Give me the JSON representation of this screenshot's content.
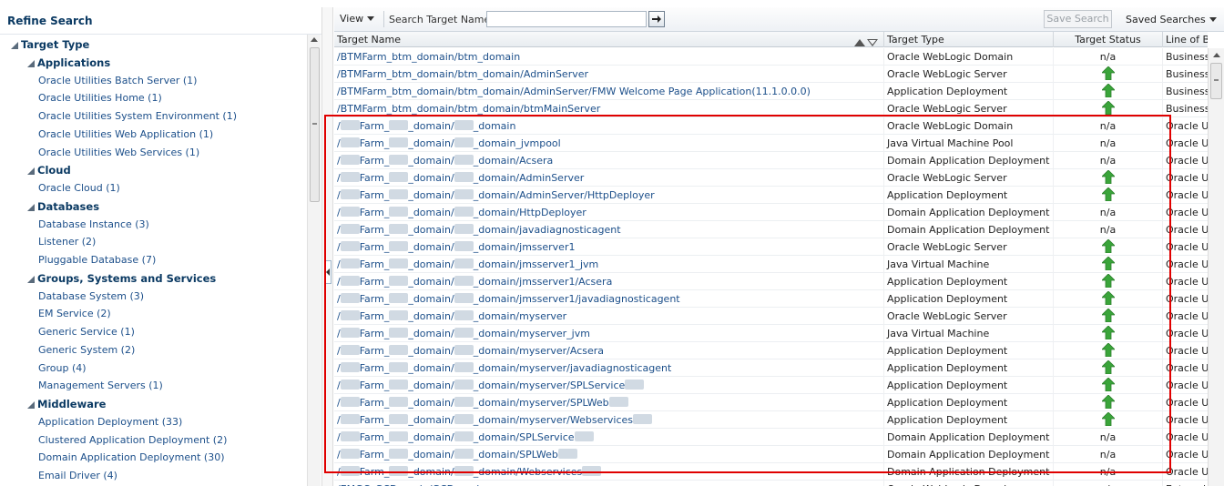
{
  "refine_panel": {
    "title": "Refine Search",
    "tree": [
      {
        "label": "Target Type",
        "level": 0
      },
      {
        "label": "Applications",
        "level": 1
      },
      {
        "label": "Oracle Utilities Batch Server  (1)",
        "level": 2
      },
      {
        "label": "Oracle Utilities Home  (1)",
        "level": 2
      },
      {
        "label": "Oracle Utilities System Environment  (1)",
        "level": 2
      },
      {
        "label": "Oracle Utilities Web Application  (1)",
        "level": 2
      },
      {
        "label": "Oracle Utilities Web Services  (1)",
        "level": 2
      },
      {
        "label": "Cloud",
        "level": 1
      },
      {
        "label": "Oracle Cloud  (1)",
        "level": 2
      },
      {
        "label": "Databases",
        "level": 1
      },
      {
        "label": "Database Instance  (3)",
        "level": 2
      },
      {
        "label": "Listener  (2)",
        "level": 2
      },
      {
        "label": "Pluggable Database  (7)",
        "level": 2
      },
      {
        "label": "Groups, Systems and Services",
        "level": 1
      },
      {
        "label": "Database System  (3)",
        "level": 2
      },
      {
        "label": "EM Service  (2)",
        "level": 2
      },
      {
        "label": "Generic Service  (1)",
        "level": 2
      },
      {
        "label": "Generic System  (2)",
        "level": 2
      },
      {
        "label": "Group  (4)",
        "level": 2
      },
      {
        "label": "Management Servers  (1)",
        "level": 2
      },
      {
        "label": "Middleware",
        "level": 1
      },
      {
        "label": "Application Deployment  (33)",
        "level": 2
      },
      {
        "label": "Clustered Application Deployment  (2)",
        "level": 2
      },
      {
        "label": "Domain Application Deployment  (30)",
        "level": 2
      },
      {
        "label": "Email Driver  (4)",
        "level": 2
      }
    ]
  },
  "toolbar": {
    "view_label": "View",
    "search_label": "Search Target Name",
    "search_value": "",
    "save_search_label": "Save Search",
    "saved_searches_label": "Saved Searches"
  },
  "table": {
    "headers": {
      "name": "Target Name",
      "type": "Target Type",
      "status": "Target Status",
      "lob": "Line of Bu"
    },
    "rows": [
      {
        "name": "/BTMFarm_btm_domain/btm_domain",
        "type": "Oracle WebLogic Domain",
        "status": "n/a",
        "lob": "Business"
      },
      {
        "name": "/BTMFarm_btm_domain/btm_domain/AdminServer",
        "type": "Oracle WebLogic Server",
        "status": "up",
        "lob": "Business"
      },
      {
        "name": "/BTMFarm_btm_domain/btm_domain/AdminServer/FMW Welcome Page Application(11.1.0.0.0)",
        "type": "Application Deployment",
        "status": "up",
        "lob": "Business"
      },
      {
        "name": "/BTMFarm_btm_domain/btm_domain/btmMainServer",
        "type": "Oracle WebLogic Server",
        "status": "up",
        "lob": "Business"
      },
      {
        "name": "/▒▒▒Farm_▒▒▒_domain/▒▒▒_domain",
        "type": "Oracle WebLogic Domain",
        "status": "n/a",
        "lob": "Oracle U"
      },
      {
        "name": "/▒▒▒Farm_▒▒▒_domain/▒▒▒_domain_jvmpool",
        "type": "Java Virtual Machine Pool",
        "status": "n/a",
        "lob": "Oracle U"
      },
      {
        "name": "/▒▒▒Farm_▒▒▒_domain/▒▒▒_domain/Acsera",
        "type": "Domain Application Deployment",
        "status": "n/a",
        "lob": "Oracle U"
      },
      {
        "name": "/▒▒▒Farm_▒▒▒_domain/▒▒▒_domain/AdminServer",
        "type": "Oracle WebLogic Server",
        "status": "up",
        "lob": "Oracle U"
      },
      {
        "name": "/▒▒▒Farm_▒▒▒_domain/▒▒▒_domain/AdminServer/HttpDeployer",
        "type": "Application Deployment",
        "status": "up",
        "lob": "Oracle U"
      },
      {
        "name": "/▒▒▒Farm_▒▒▒_domain/▒▒▒_domain/HttpDeployer",
        "type": "Domain Application Deployment",
        "status": "n/a",
        "lob": "Oracle U"
      },
      {
        "name": "/▒▒▒Farm_▒▒▒_domain/▒▒▒_domain/javadiagnosticagent",
        "type": "Domain Application Deployment",
        "status": "n/a",
        "lob": "Oracle U"
      },
      {
        "name": "/▒▒▒Farm_▒▒▒_domain/▒▒▒_domain/jmsserver1",
        "type": "Oracle WebLogic Server",
        "status": "up",
        "lob": "Oracle U"
      },
      {
        "name": "/▒▒▒Farm_▒▒▒_domain/▒▒▒_domain/jmsserver1_jvm",
        "type": "Java Virtual Machine",
        "status": "up",
        "lob": "Oracle U"
      },
      {
        "name": "/▒▒▒Farm_▒▒▒_domain/▒▒▒_domain/jmsserver1/Acsera",
        "type": "Application Deployment",
        "status": "up",
        "lob": "Oracle U"
      },
      {
        "name": "/▒▒▒Farm_▒▒▒_domain/▒▒▒_domain/jmsserver1/javadiagnosticagent",
        "type": "Application Deployment",
        "status": "up",
        "lob": "Oracle U"
      },
      {
        "name": "/▒▒▒Farm_▒▒▒_domain/▒▒▒_domain/myserver",
        "type": "Oracle WebLogic Server",
        "status": "up",
        "lob": "Oracle U"
      },
      {
        "name": "/▒▒▒Farm_▒▒▒_domain/▒▒▒_domain/myserver_jvm",
        "type": "Java Virtual Machine",
        "status": "up",
        "lob": "Oracle U"
      },
      {
        "name": "/▒▒▒Farm_▒▒▒_domain/▒▒▒_domain/myserver/Acsera",
        "type": "Application Deployment",
        "status": "up",
        "lob": "Oracle U"
      },
      {
        "name": "/▒▒▒Farm_▒▒▒_domain/▒▒▒_domain/myserver/javadiagnosticagent",
        "type": "Application Deployment",
        "status": "up",
        "lob": "Oracle U"
      },
      {
        "name": "/▒▒▒Farm_▒▒▒_domain/▒▒▒_domain/myserver/SPLService▒▒▒",
        "type": "Application Deployment",
        "status": "up",
        "lob": "Oracle U"
      },
      {
        "name": "/▒▒▒Farm_▒▒▒_domain/▒▒▒_domain/myserver/SPLWeb▒▒▒",
        "type": "Application Deployment",
        "status": "up",
        "lob": "Oracle U"
      },
      {
        "name": "/▒▒▒Farm_▒▒▒_domain/▒▒▒_domain/myserver/Webservices▒▒▒",
        "type": "Application Deployment",
        "status": "up",
        "lob": "Oracle U"
      },
      {
        "name": "/▒▒▒Farm_▒▒▒_domain/▒▒▒_domain/SPLService▒▒▒",
        "type": "Domain Application Deployment",
        "status": "n/a",
        "lob": "Oracle U"
      },
      {
        "name": "/▒▒▒Farm_▒▒▒_domain/▒▒▒_domain/SPLWeb▒▒▒",
        "type": "Domain Application Deployment",
        "status": "n/a",
        "lob": "Oracle U"
      },
      {
        "name": "/▒▒▒Farm_▒▒▒_domain/▒▒▒_domain/Webservices▒▒▒",
        "type": "Domain Application Deployment",
        "status": "n/a",
        "lob": "Oracle U"
      },
      {
        "name": "/EMGC_GCDomain/GCDomain",
        "type": "Oracle WebLogic Domain",
        "status": "n/a",
        "lob": "Enterpris"
      }
    ]
  },
  "icons": {
    "status_up": "green-up-arrow-icon",
    "go": "arrow-right-icon"
  },
  "colors": {
    "link": "#1c4f8a",
    "up_arrow": "#3aa53a",
    "highlight": "#e00000"
  }
}
